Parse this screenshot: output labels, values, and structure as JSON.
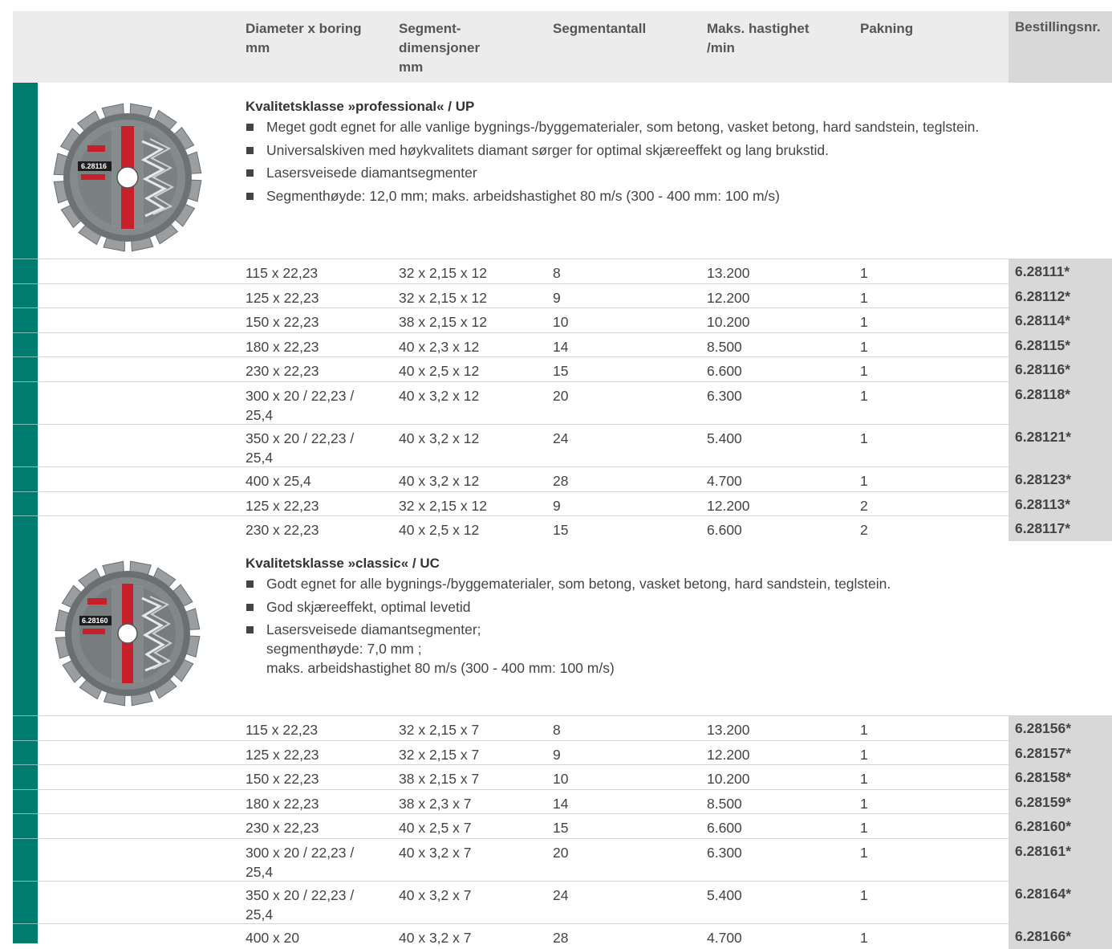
{
  "header": {
    "columns": [
      "Diameter x boring\nmm",
      "Segment-\ndimensjoner\nmm",
      "Segmentantall",
      "Maks. hastighet\n/min",
      "Pakning"
    ],
    "order_column": "Bestillingsnr."
  },
  "sections": [
    {
      "title": "Kvalitetsklasse »professional« / UP",
      "disc_label": "6.28116",
      "bullets": [
        "Meget godt egnet for alle vanlige bygnings-/byggematerialer, som betong, vasket betong, hard sandstein, teglstein.",
        "Universalskiven med høykvalitets diamant sørger for optimal skjæreeffekt og lang brukstid.",
        "Lasersveisede diamantsegmenter",
        "Segmenthøyde: 12,0 mm; maks. arbeidshastighet 80 m/s (300 - 400 mm: 100 m/s)"
      ],
      "rows": [
        {
          "diameter": "115 x 22,23",
          "segment": "32 x 2,15 x 12",
          "count": "8",
          "speed": "13.200",
          "pack": "1",
          "order": "6.28111*"
        },
        {
          "diameter": "125 x 22,23",
          "segment": "32 x 2,15 x 12",
          "count": "9",
          "speed": "12.200",
          "pack": "1",
          "order": "6.28112*"
        },
        {
          "diameter": "150 x 22,23",
          "segment": "38 x 2,15 x 12",
          "count": "10",
          "speed": "10.200",
          "pack": "1",
          "order": "6.28114*"
        },
        {
          "diameter": "180 x 22,23",
          "segment": "40 x 2,3 x 12",
          "count": "14",
          "speed": "8.500",
          "pack": "1",
          "order": "6.28115*"
        },
        {
          "diameter": "230 x 22,23",
          "segment": "40 x 2,5 x 12",
          "count": "15",
          "speed": "6.600",
          "pack": "1",
          "order": "6.28116*"
        },
        {
          "diameter": "300 x 20 / 22,23 /\n25,4",
          "segment": "40 x 3,2 x 12",
          "count": "20",
          "speed": "6.300",
          "pack": "1",
          "order": "6.28118*"
        },
        {
          "diameter": "350 x 20 / 22,23 /\n25,4",
          "segment": "40 x 3,2 x 12",
          "count": "24",
          "speed": "5.400",
          "pack": "1",
          "order": "6.28121*"
        },
        {
          "diameter": "400 x 25,4",
          "segment": "40 x 3,2 x 12",
          "count": "28",
          "speed": "4.700",
          "pack": "1",
          "order": "6.28123*"
        },
        {
          "diameter": "125 x 22,23",
          "segment": "32 x 2,15 x 12",
          "count": "9",
          "speed": "12.200",
          "pack": "2",
          "order": "6.28113*"
        },
        {
          "diameter": "230 x 22,23",
          "segment": "40 x 2,5 x 12",
          "count": "15",
          "speed": "6.600",
          "pack": "2",
          "order": "6.28117*"
        }
      ]
    },
    {
      "title": "Kvalitetsklasse »classic« / UC",
      "disc_label": "6.28160",
      "bullets": [
        "Godt egnet for alle bygnings-/byggematerialer, som betong, vasket betong, hard sandstein, teglstein.",
        "God skjæreeffekt, optimal levetid",
        "Lasersveisede diamantsegmenter;\nsegmenthøyde: 7,0 mm ;\nmaks. arbeidshastighet 80 m/s (300 - 400 mm: 100 m/s)"
      ],
      "rows": [
        {
          "diameter": "115 x 22,23",
          "segment": "32 x 2,15 x 7",
          "count": "8",
          "speed": "13.200",
          "pack": "1",
          "order": "6.28156*"
        },
        {
          "diameter": "125 x 22,23",
          "segment": "32 x 2,15 x 7",
          "count": "9",
          "speed": "12.200",
          "pack": "1",
          "order": "6.28157*"
        },
        {
          "diameter": "150 x 22,23",
          "segment": "38 x 2,15 x 7",
          "count": "10",
          "speed": "10.200",
          "pack": "1",
          "order": "6.28158*"
        },
        {
          "diameter": "180 x 22,23",
          "segment": "38 x 2,3 x 7",
          "count": "14",
          "speed": "8.500",
          "pack": "1",
          "order": "6.28159*"
        },
        {
          "diameter": "230 x 22,23",
          "segment": "40 x 2,5 x 7",
          "count": "15",
          "speed": "6.600",
          "pack": "1",
          "order": "6.28160*"
        },
        {
          "diameter": "300 x 20 / 22,23 /\n25,4",
          "segment": "40 x 3,2 x 7",
          "count": "20",
          "speed": "6.300",
          "pack": "1",
          "order": "6.28161*"
        },
        {
          "diameter": "350 x 20 / 22,23 /\n25,4",
          "segment": "40 x 3,2 x 7",
          "count": "24",
          "speed": "5.400",
          "pack": "1",
          "order": "6.28164*"
        },
        {
          "diameter": "400 x 20",
          "segment": "40 x 3,2 x 7",
          "count": "28",
          "speed": "4.700",
          "pack": "1",
          "order": "6.28166*"
        }
      ]
    }
  ],
  "colors": {
    "accent": "#007c6e",
    "header_bg": "#ececec",
    "order_bg": "#d8d8d8",
    "disc_red": "#c8202a"
  }
}
